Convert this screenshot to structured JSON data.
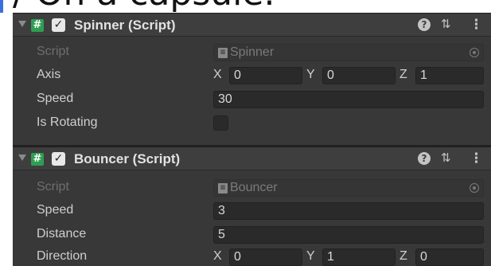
{
  "caption": {
    "text": "/ On a capsule.",
    "accent_color": "#3b6fe0"
  },
  "components": [
    {
      "title": "Spinner (Script)",
      "enabled": true,
      "script_label": "Script",
      "script_value": "Spinner",
      "fields": {
        "axis": {
          "label": "Axis",
          "x_label": "X",
          "x": "0",
          "y_label": "Y",
          "y": "0",
          "z_label": "Z",
          "z": "1"
        },
        "speed": {
          "label": "Speed",
          "value": "30"
        },
        "is_rotating": {
          "label": "Is Rotating",
          "checked": false
        }
      }
    },
    {
      "title": "Bouncer (Script)",
      "enabled": true,
      "script_label": "Script",
      "script_value": "Bouncer",
      "fields": {
        "speed": {
          "label": "Speed",
          "value": "3"
        },
        "distance": {
          "label": "Distance",
          "value": "5"
        },
        "direction": {
          "label": "Direction",
          "x_label": "X",
          "x": "0",
          "y_label": "Y",
          "y": "1",
          "z_label": "Z",
          "z": "0"
        }
      }
    }
  ],
  "icons": {
    "foldout": "triangle-down-icon",
    "script": "csharp-script-icon",
    "enable": "checkbox-checked-icon",
    "help": "help-icon",
    "presets": "presets-sliders-icon",
    "menu": "kebab-menu-icon",
    "script_file": "script-file-icon",
    "object_picker": "object-picker-icon"
  },
  "colors": {
    "panel_bg": "#383838",
    "header_bg": "#3e3e3e",
    "field_bg": "#2a2a2a",
    "script_icon": "#2f9e52"
  }
}
